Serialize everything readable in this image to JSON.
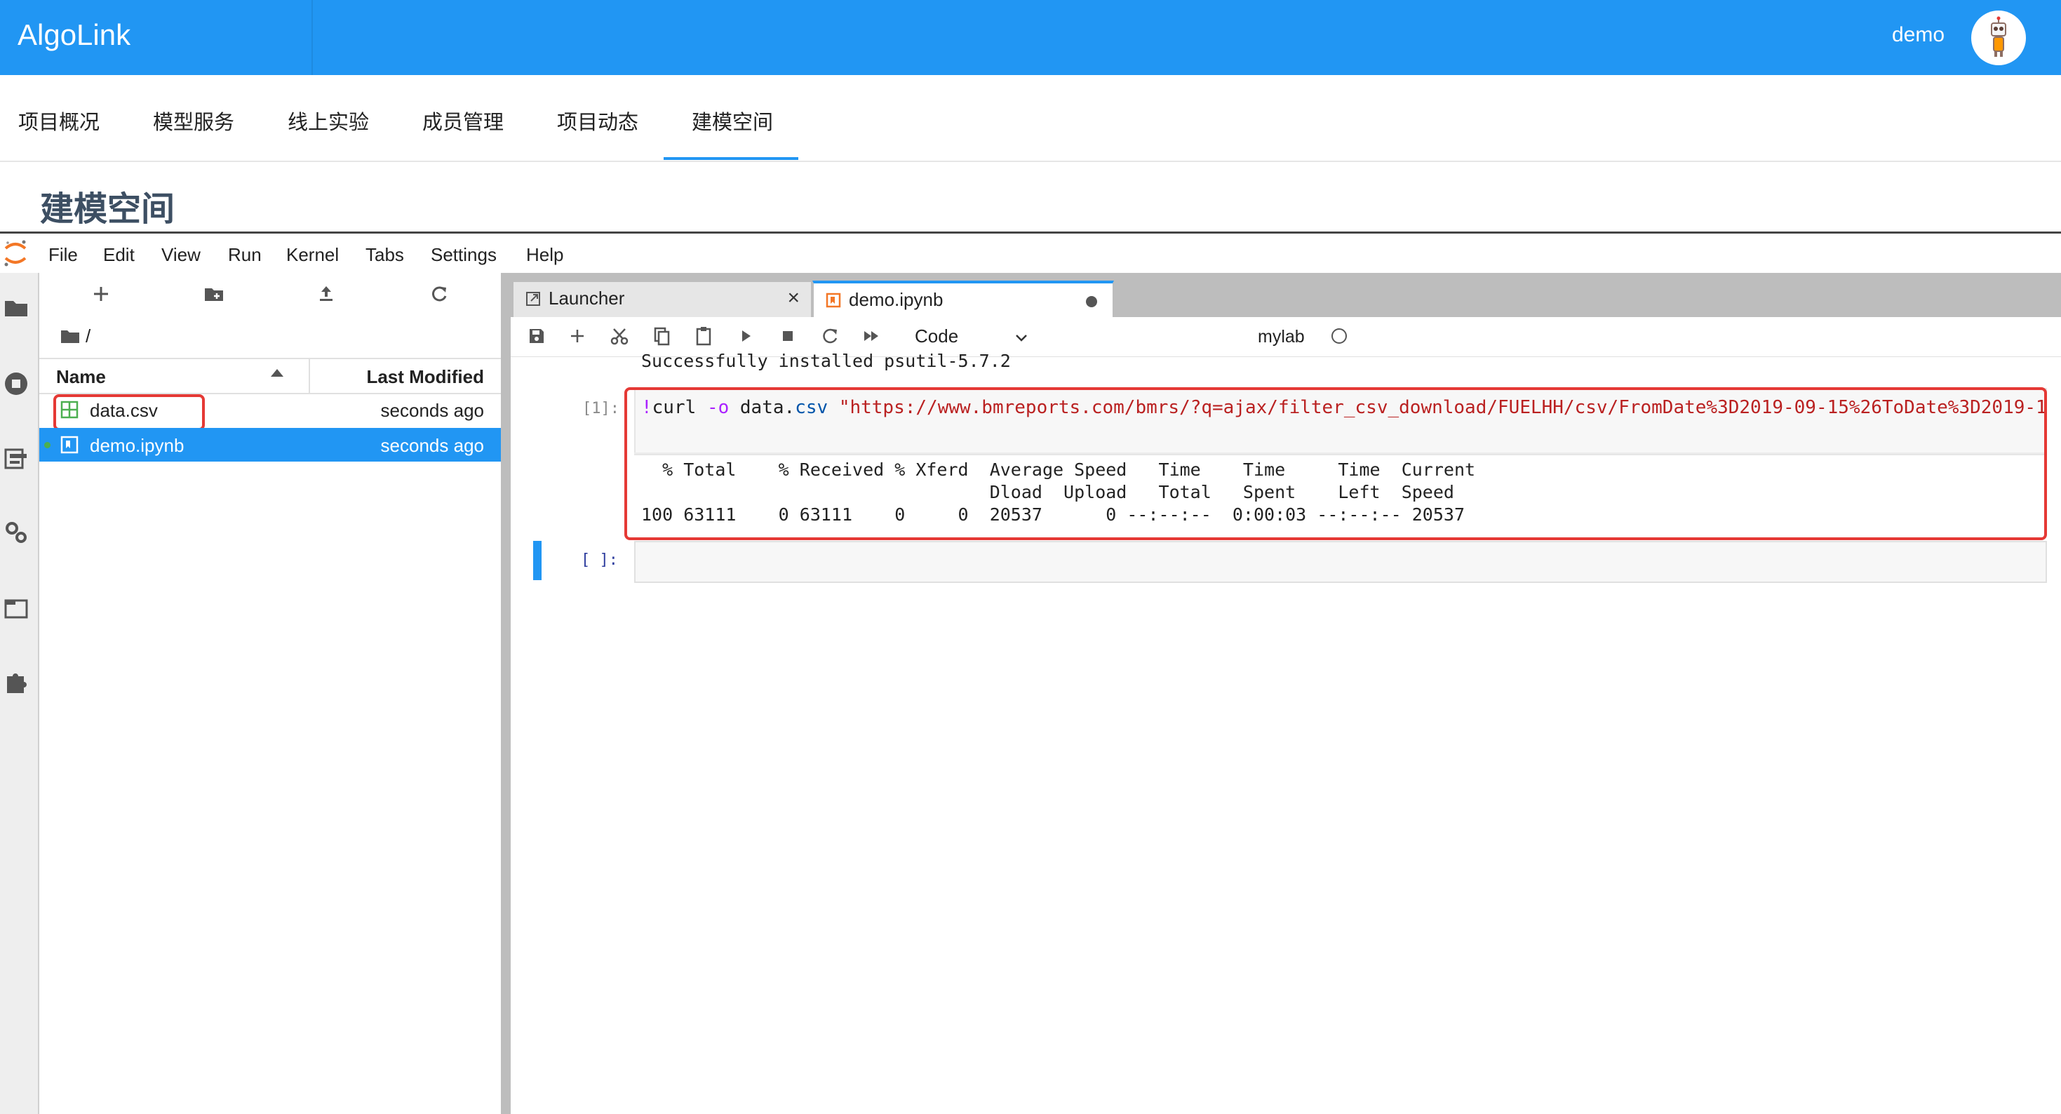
{
  "app": {
    "brand": "AlgoLink",
    "user": "demo"
  },
  "project_nav": {
    "tabs": [
      "项目概况",
      "模型服务",
      "线上实验",
      "成员管理",
      "项目动态",
      "建模空间"
    ],
    "active": "建模空间"
  },
  "page_title": "建模空间",
  "menu": [
    "File",
    "Edit",
    "View",
    "Run",
    "Kernel",
    "Tabs",
    "Settings",
    "Help"
  ],
  "filebrowser": {
    "breadcrumb": "/",
    "columns": {
      "name": "Name",
      "modified": "Last Modified"
    },
    "files": [
      {
        "name": "data.csv",
        "modified": "seconds ago",
        "icon": "spreadsheet-icon",
        "selected": false
      },
      {
        "name": "demo.ipynb",
        "modified": "seconds ago",
        "icon": "notebook-icon",
        "selected": true
      }
    ]
  },
  "tabs": [
    {
      "label": "Launcher",
      "icon": "launcher-icon",
      "active": false
    },
    {
      "label": "demo.ipynb",
      "icon": "notebook-icon",
      "active": true
    }
  ],
  "toolbar": {
    "cell_type": "Code",
    "kernel": "mylab"
  },
  "notebook": {
    "prev_output": "Successfully installed psutil-5.7.2",
    "cell1": {
      "prompt": "[1]:",
      "code_bang": "!",
      "code_cmd": "curl ",
      "code_flag": "-o",
      "code_mid": " data",
      "code_dot": ".",
      "code_attr": "csv",
      "code_str": "\"https://www.bmreports.com/bmrs/?q=ajax/filter_csv_download/FUELHH/csv/FromDate%3D2019-09-15%26ToDate%3D2019-1",
      "output_lines": [
        "  % Total    % Received % Xferd  Average Speed   Time    Time     Time  Current",
        "                                 Dload  Upload   Total   Spent    Left  Speed",
        "100 63111    0 63111    0     0  20537      0 --:--:--  0:00:03 --:--:-- 20537"
      ]
    },
    "cell2": {
      "prompt": "[ ]:"
    }
  },
  "colors": {
    "accent": "#2196f3",
    "highlight": "#e53935",
    "running": "#4caf50"
  }
}
